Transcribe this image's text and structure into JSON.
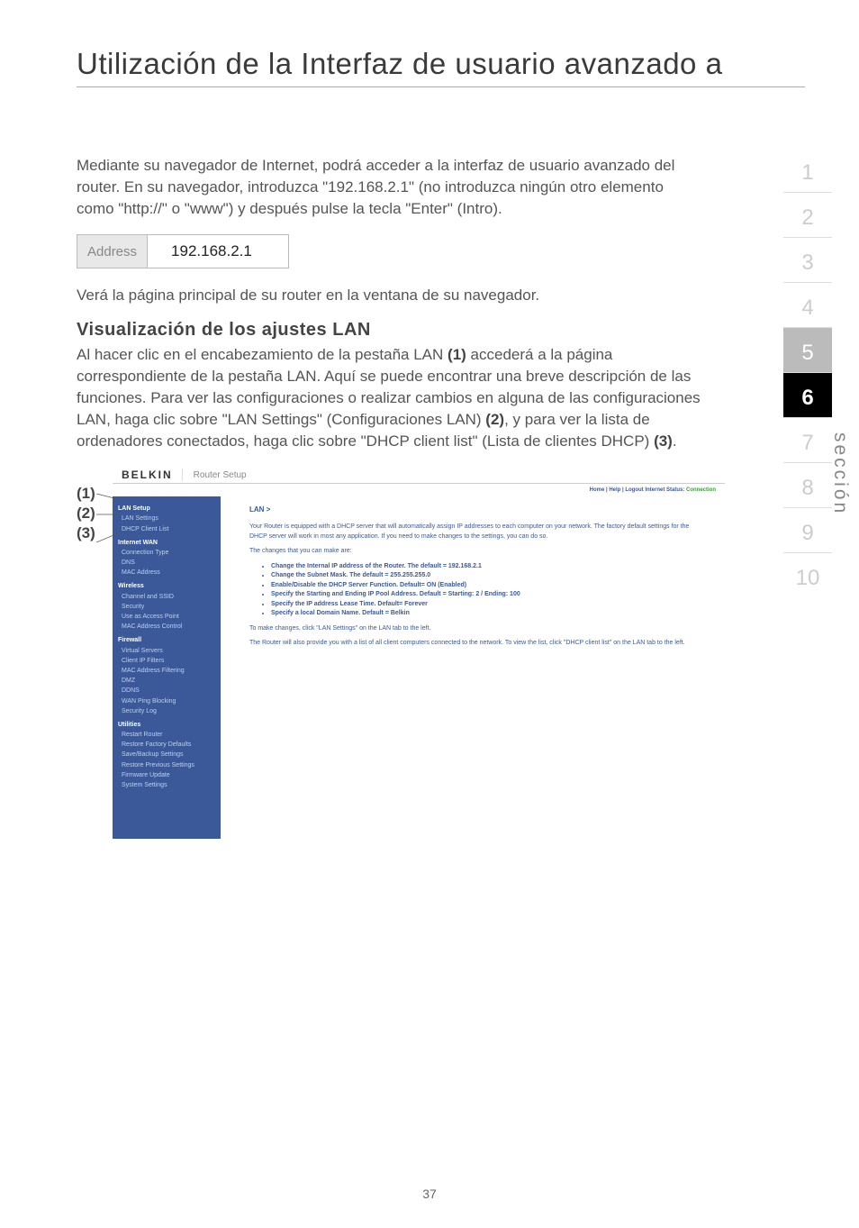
{
  "title": "Utilización de la Interfaz de usuario avanzado a",
  "intro": "Mediante su navegador de Internet, podrá acceder a la interfaz de usuario avanzado del router. En su navegador, introduzca \"192.168.2.1\" (no introduzca ningún otro elemento como \"http://\" o \"www\") y después pulse la tecla \"Enter\" (Intro).",
  "address_label": "Address",
  "address_value": "192.168.2.1",
  "mid_text": "Verá la página principal de su router en la ventana de su navegador.",
  "subtitle": "Visualización de los ajustes LAN",
  "body_parts": {
    "p1": "Al hacer clic en el encabezamiento de la pestaña LAN ",
    "b1": "(1)",
    "p2": " accederá a la página correspondiente de la pestaña LAN. Aquí se puede encontrar una breve descripción de las funciones. Para ver las configuraciones o realizar cambios en alguna de las configuraciones LAN, haga clic sobre \"LAN Settings\" (Configuraciones LAN) ",
    "b2": "(2)",
    "p3": ", y para ver la lista de ordenadores conectados, haga clic sobre \"DHCP client list\" (Lista de clientes DHCP) ",
    "b3": "(3)",
    "p4": "."
  },
  "nav": [
    "1",
    "2",
    "3",
    "4",
    "5",
    "6",
    "7",
    "8",
    "9",
    "10"
  ],
  "nav_section_label": "sección",
  "callouts": [
    "(1)",
    "(2)",
    "(3)"
  ],
  "ui": {
    "logo": "BELKIN",
    "title": "Router Setup",
    "topmeta_left": "Home | Help | Logout    Internet Status: ",
    "topmeta_status": "Connection",
    "crumb": "LAN >",
    "para1": "Your Router is equipped with a DHCP server that will automatically assign IP addresses to each computer on your network. The factory default settings for the DHCP server will work in most any application. If you need to make changes to the settings, you can do so.",
    "para2": "The changes that you can make are:",
    "bullets": [
      "Change the Internal IP address of the Router. The default = 192.168.2.1",
      "Change the Subnet Mask. The default = 255.255.255.0",
      "Enable/Disable the DHCP Server Function. Default= ON (Enabled)",
      "Specify the Starting and Ending IP Pool Address. Default = Starting: 2 / Ending: 100",
      "Specify the IP address Lease Time. Default= Forever",
      "Specify a local Domain Name. Default = Belkin"
    ],
    "para3": "To make changes, click \"LAN Settings\" on the LAN tab to the left.",
    "para4": "The Router will also provide you with a list of all client computers connected to the network. To view the list, click \"DHCP client list\" on the LAN tab to the left.",
    "sidebar": {
      "groups": [
        {
          "h": "LAN Setup",
          "items": [
            "LAN Settings",
            "DHCP Client List"
          ]
        },
        {
          "h": "Internet WAN",
          "items": [
            "Connection Type",
            "DNS",
            "MAC Address"
          ]
        },
        {
          "h": "Wireless",
          "items": [
            "Channel and SSID",
            "Security",
            "Use as Access Point",
            "MAC Address Control"
          ]
        },
        {
          "h": "Firewall",
          "items": [
            "Virtual Servers",
            "Client IP Filters",
            "MAC Address Filtering",
            "DMZ",
            "DDNS",
            "WAN Ping Blocking",
            "Security Log"
          ]
        },
        {
          "h": "Utilities",
          "items": [
            "Restart Router",
            "Restore Factory Defaults",
            "Save/Backup Settings",
            "Restore Previous Settings",
            "Firmware Update",
            "System Settings"
          ]
        }
      ]
    }
  },
  "page_num": "37"
}
